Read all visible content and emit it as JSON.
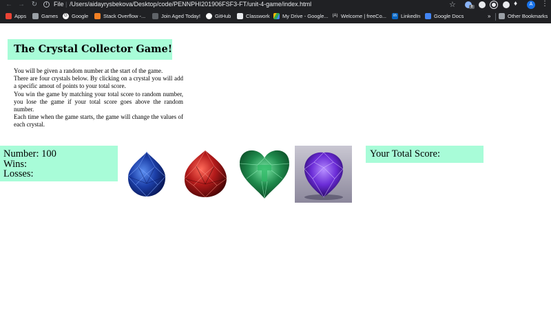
{
  "browser": {
    "url_scheme_label": "File",
    "url_path": "/Users/aidayrysbekova/Desktop/code/PENNPHI201906FSF3-FT/unit-4-game/index.html",
    "avatar_letter": "A",
    "extension_badge": "8",
    "bookmarks": [
      {
        "label": "Apps",
        "icon": "apps-grid-icon"
      },
      {
        "label": "Games",
        "icon": "folder-icon"
      },
      {
        "label": "Google",
        "icon": "google-icon"
      },
      {
        "label": "Stack Overflow -...",
        "icon": "stackoverflow-icon"
      },
      {
        "label": "Join Aged Today!",
        "icon": "page-icon"
      },
      {
        "label": "GitHub",
        "icon": "github-icon"
      },
      {
        "label": "Classwork",
        "icon": "classroom-icon"
      },
      {
        "label": "My Drive - Google...",
        "icon": "drive-icon"
      },
      {
        "label": "Welcome | freeCo...",
        "icon": "freecodecamp-icon"
      },
      {
        "label": "LinkedIn",
        "icon": "linkedin-icon"
      },
      {
        "label": "Google Docs",
        "icon": "docs-icon"
      }
    ],
    "more_bookmarks": "»",
    "other_bookmarks": "Other Bookmarks"
  },
  "page": {
    "title": "The Crystal Collector Game!",
    "instructions": [
      "You will be given a random number at the start of the game.",
      "There are four crystals below. By clicking on a crystal you will add a specific amout of points to your total score.",
      "You win the game by matching your total score to random number, you lose the game if your total score goes above the random number.",
      "Each time when the game starts, the game will change the values of each crystal."
    ],
    "stats": {
      "number": "Number: 100",
      "wins": "Wins:",
      "losses": "Losses:"
    },
    "score_label": "Your Total Score:",
    "crystals": [
      {
        "name": "blue-crystal",
        "color": "#1c3fa8"
      },
      {
        "name": "red-crystal",
        "color": "#b51b1b"
      },
      {
        "name": "green-crystal",
        "color": "#1f8a4c"
      },
      {
        "name": "purple-crystal",
        "color": "#6a2bd6"
      }
    ],
    "colors": {
      "panel": "#a8fcd8",
      "chrome": "#202124"
    }
  }
}
